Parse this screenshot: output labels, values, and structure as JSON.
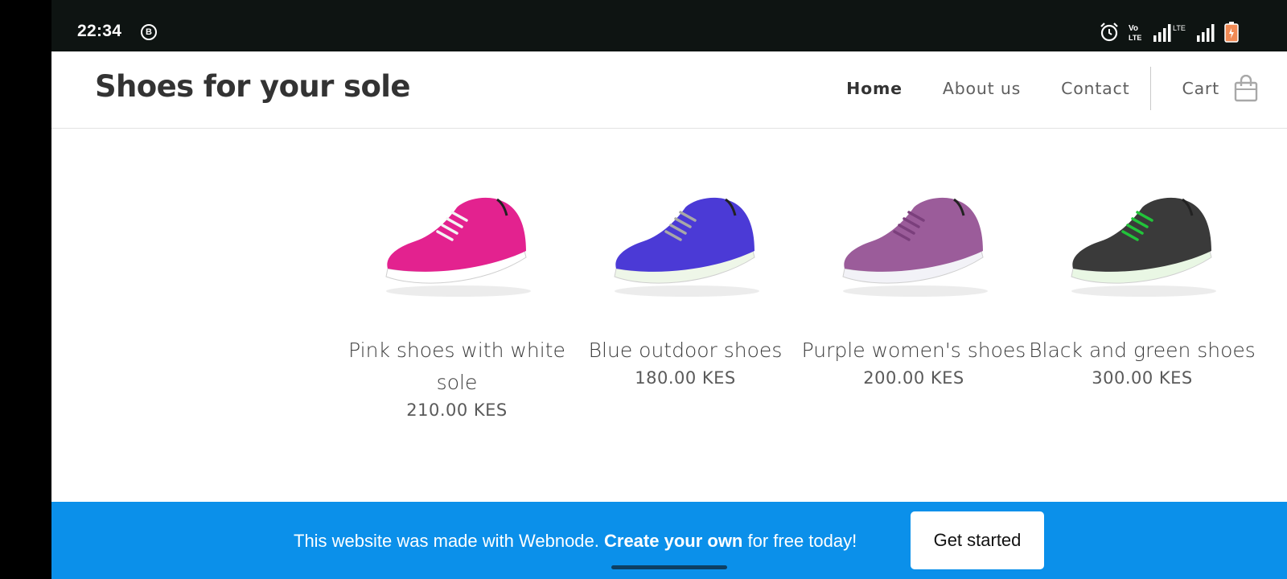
{
  "status_bar": {
    "time": "22:34",
    "notification_badge": "B",
    "network_label": "LTE",
    "volte_label": "Vo LTE",
    "icons": [
      "alarm-icon",
      "volte-icon",
      "signal-icon",
      "signal-icon",
      "battery-icon"
    ]
  },
  "header": {
    "brand": "Shoes for your sole",
    "nav": [
      {
        "label": "Home",
        "active": true
      },
      {
        "label": "About us",
        "active": false
      },
      {
        "label": "Contact",
        "active": false
      }
    ],
    "cart_label": "Cart",
    "cart_icon": "shopping-bag-icon"
  },
  "products": [
    {
      "name": "Pink shoes with white sole",
      "price": "210.00 KES",
      "color": "#e3228f",
      "lace": "#f4f4f4",
      "sole": "#ffffff"
    },
    {
      "name": "Blue outdoor shoes",
      "price": "180.00 KES",
      "color": "#4b3ad6",
      "lace": "#a8a8a8",
      "sole": "#eef6e8"
    },
    {
      "name": "Purple women's shoes",
      "price": "200.00 KES",
      "color": "#9b5c9a",
      "lace": "#7b3f7c",
      "sole": "#f2f2f7"
    },
    {
      "name": "Black and green shoes",
      "price": "300.00 KES",
      "color": "#3a3a3a",
      "lace": "#22c43a",
      "sole": "#e9f7e4"
    }
  ],
  "banner": {
    "text_before": "This website was made with Webnode. ",
    "text_bold": "Create your own",
    "text_after": " for free today!",
    "cta_label": "Get started",
    "color": "#0b90ea"
  }
}
